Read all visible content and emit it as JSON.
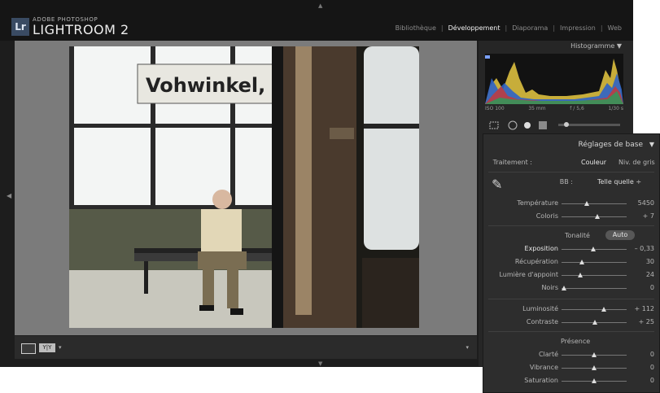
{
  "app": {
    "brand_small": "ADOBE PHOTOSHOP",
    "brand_name": "LIGHTROOM 2",
    "logo_text": "Lr",
    "modules": [
      "Bibliothèque",
      "Développement",
      "Diaporama",
      "Impression",
      "Web"
    ],
    "active_module": "Développement"
  },
  "photo": {
    "sign_text": "Vohwinkel, Sch"
  },
  "histogram": {
    "label": "Histogramme",
    "info": [
      "ISO 100",
      "35 mm",
      "f / 5,6",
      "1/30 s"
    ]
  },
  "basic": {
    "title": "Réglages de base",
    "treatment_label": "Traitement :",
    "treatment_options": [
      "Couleur",
      "Niv. de gris"
    ],
    "wb_label": "BB :",
    "wb_value": "Telle quelle ÷",
    "temperature": {
      "label": "Température",
      "value": "5450"
    },
    "tint": {
      "label": "Coloris",
      "value": "+ 7"
    },
    "tone_label": "Tonalité",
    "auto_label": "Auto",
    "exposure": {
      "label": "Exposition",
      "value": "– 0,33"
    },
    "recovery": {
      "label": "Récupération",
      "value": "30"
    },
    "fill": {
      "label": "Lumière d'appoint",
      "value": "24"
    },
    "blacks": {
      "label": "Noirs",
      "value": "0"
    },
    "brightness": {
      "label": "Luminosité",
      "value": "+ 112"
    },
    "contrast": {
      "label": "Contraste",
      "value": "+ 25"
    },
    "presence_label": "Présence",
    "clarity": {
      "label": "Clarté",
      "value": "0"
    },
    "vibrance": {
      "label": "Vibrance",
      "value": "0"
    },
    "saturation": {
      "label": "Saturation",
      "value": "0"
    }
  },
  "toolbar": {
    "ab_label": "Y|Y"
  }
}
